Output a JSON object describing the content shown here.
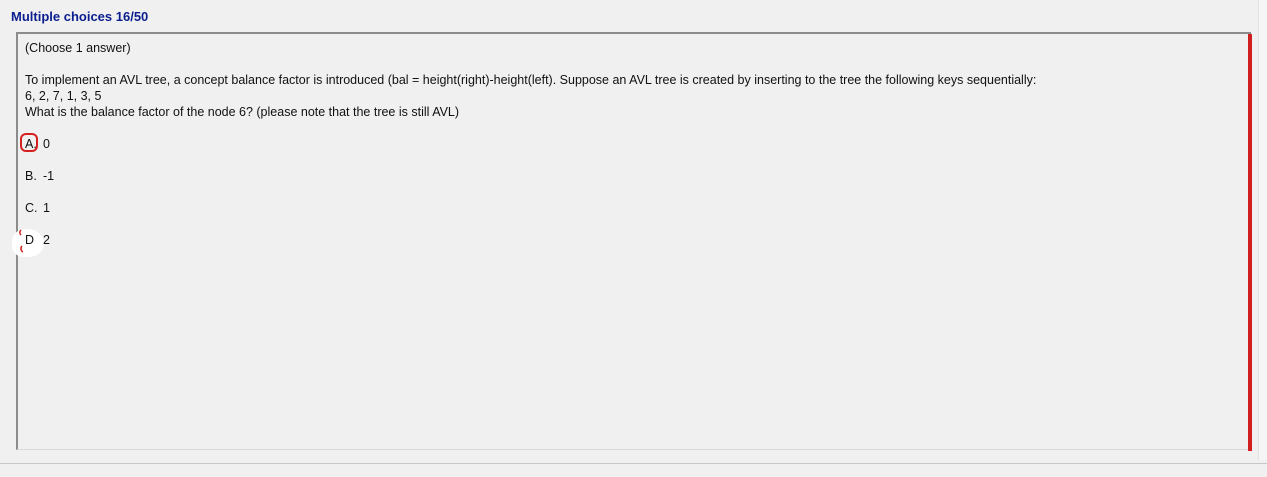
{
  "header": {
    "title": "Multiple choices 16/50"
  },
  "question": {
    "instruction": "(Choose 1 answer)",
    "line1": "To implement an AVL tree, a concept balance factor is introduced (bal = height(right)-height(left). Suppose an AVL tree is created by inserting to the tree the following keys sequentially:",
    "line2": "6, 2, 7, 1, 3, 5",
    "line3": "What is the balance factor of the node 6? (please note that the tree is still AVL)"
  },
  "options": [
    {
      "letter": "A.",
      "value": "0"
    },
    {
      "letter": "B.",
      "value": "-1"
    },
    {
      "letter": "C.",
      "value": "1"
    },
    {
      "letter": "D",
      "value": "2"
    }
  ],
  "colors": {
    "title": "#0a1e8f",
    "accent_bar": "#d11f1f",
    "annotation": "#d62020"
  },
  "annotations": {
    "circled_option": "A."
  }
}
